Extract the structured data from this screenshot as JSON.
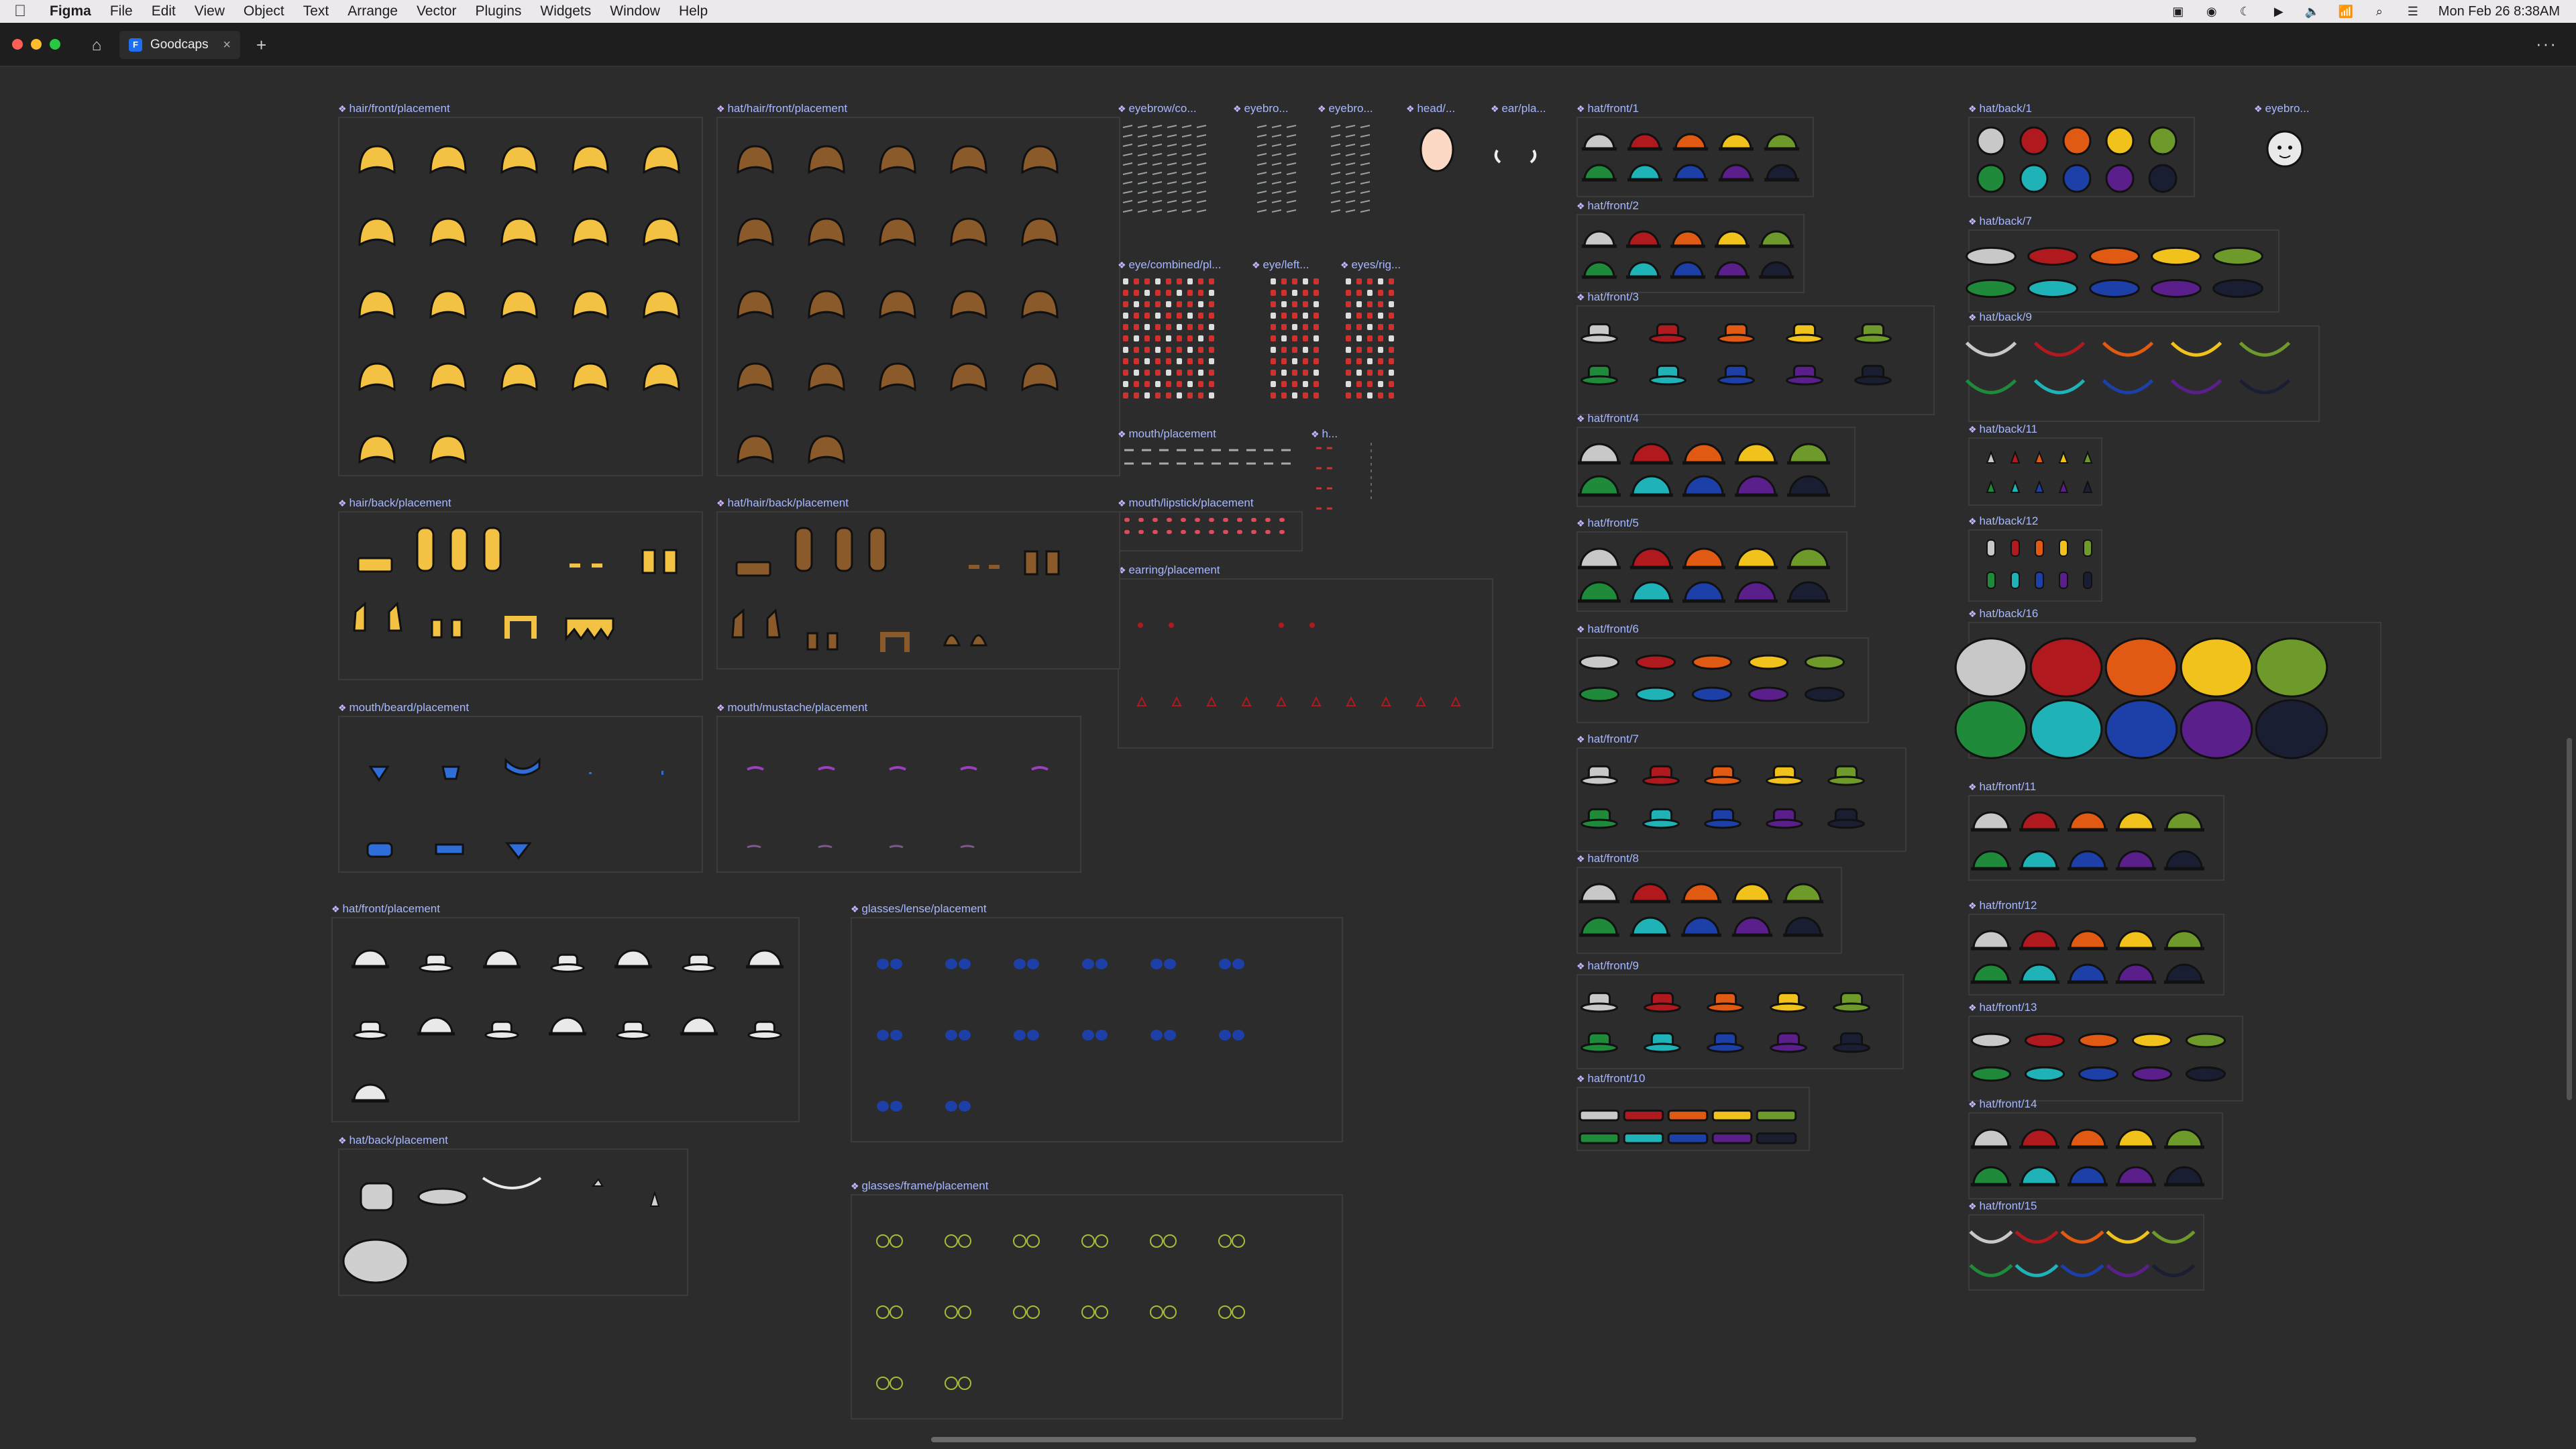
{
  "menubar": {
    "app": "Figma",
    "items": [
      "File",
      "Edit",
      "View",
      "Object",
      "Text",
      "Arrange",
      "Vector",
      "Plugins",
      "Widgets",
      "Window",
      "Help"
    ],
    "clock": "Mon Feb 26  8:38AM"
  },
  "tabbar": {
    "tab_title": "Goodcaps",
    "tab_icon": "figma-file-icon"
  },
  "palette": {
    "colors": [
      "#c8c8c8",
      "#b0191e",
      "#e05a14",
      "#f1c21b",
      "#6d9a2a",
      "#1f8a3a",
      "#1fb3b8",
      "#1d3fa8",
      "#5a1f8a",
      "#1a1e33"
    ],
    "gold": "#f3c243",
    "brown": "#8a5a2b",
    "blue": "#2f6dd8",
    "purple": "#9a3fbf",
    "glasses_blue": "#1d3fa8",
    "glasses_frame": "#a9b93a",
    "skin": "#fcd9c5",
    "white": "#e9e9e9"
  },
  "frames": {
    "hair_front": "hair/front/placement",
    "hat_hair_front": "hat/hair/front/placement",
    "eyebrow_co": "eyebrow/co...",
    "eyebrow_2": "eyebro...",
    "eyebrow_3": "eyebro...",
    "head": "head/...",
    "ear": "ear/pla...",
    "eye_combined": "eye/combined/pl...",
    "eye_left": "eye/left...",
    "eyes_right": "eyes/rig...",
    "mouth": "mouth/placement",
    "h_short": "h...",
    "mouth_lipstick": "mouth/lipstick/placement",
    "earring": "earring/placement",
    "hair_back": "hair/back/placement",
    "hat_hair_back": "hat/hair/back/placement",
    "mouth_beard": "mouth/beard/placement",
    "mouth_mustache": "mouth/mustache/placement",
    "hat_front": "hat/front/placement",
    "glasses_lense": "glasses/lense/placement",
    "hat_back": "hat/back/placement",
    "glasses_frame": "glasses/frame/placement",
    "hat_front_1": "hat/front/1",
    "hat_front_2": "hat/front/2",
    "hat_front_3": "hat/front/3",
    "hat_front_4": "hat/front/4",
    "hat_front_5": "hat/front/5",
    "hat_front_6": "hat/front/6",
    "hat_front_7": "hat/front/7",
    "hat_front_8": "hat/front/8",
    "hat_front_9": "hat/front/9",
    "hat_front_10": "hat/front/10",
    "hat_back_1": "hat/back/1",
    "eyebro_right": "eyebro...",
    "hat_back_7": "hat/back/7",
    "hat_back_9": "hat/back/9",
    "hat_back_11": "hat/back/11",
    "hat_back_12": "hat/back/12",
    "hat_back_16": "hat/back/16",
    "hat_front_11": "hat/front/11",
    "hat_front_12": "hat/front/12",
    "hat_front_13": "hat/front/13",
    "hat_front_14": "hat/front/14",
    "hat_front_15": "hat/front/15"
  }
}
